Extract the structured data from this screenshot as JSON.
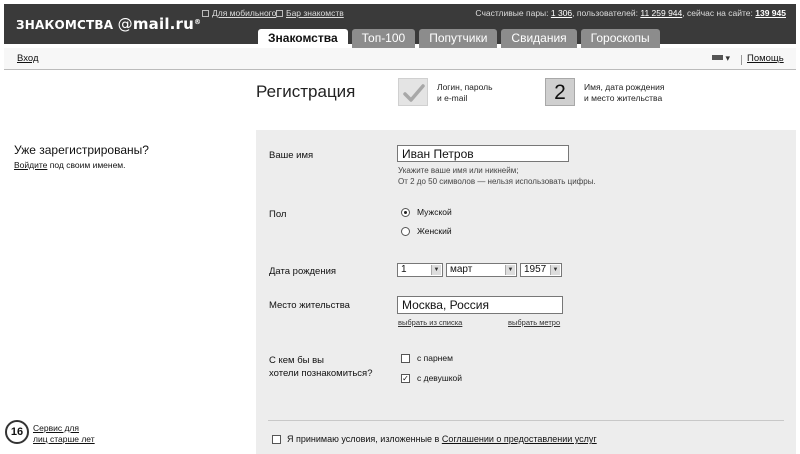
{
  "header": {
    "logo_brand": "ЗНАКОМСТВА",
    "logo_at": "@",
    "logo_mail": "mail.ru",
    "logo_reg": "®",
    "mobile_link": "Для мобильного",
    "bar_link": "Бар знакомств",
    "stats": {
      "pairs_label": "Счастливые пары:",
      "pairs": "1 306",
      "users_label": ", пользователей:",
      "users": "11 259 944",
      "online_label": ", сейчас на сайте:",
      "online": "139 945"
    },
    "tabs": [
      {
        "label": "Знакомства",
        "active": true
      },
      {
        "label": "Топ-100",
        "active": false
      },
      {
        "label": "Попутчики",
        "active": false
      },
      {
        "label": "Свидания",
        "active": false
      },
      {
        "label": "Гороскопы",
        "active": false
      }
    ]
  },
  "subbar": {
    "login": "Вход",
    "lang_arrow": "▾",
    "help": "Помощь"
  },
  "registration": {
    "title": "Регистрация",
    "step1": {
      "line1": "Логин, пароль",
      "line2": "и e-mail",
      "icon": "checkmark-icon"
    },
    "step2": {
      "number": "2",
      "line1": "Имя, дата рождения",
      "line2": "и место жительства"
    }
  },
  "left": {
    "title": "Уже зарегистрированы?",
    "login_link": "Войдите",
    "login_rest": " под своим именем.",
    "age_badge": "16",
    "age_line1": "Сервис для",
    "age_line2": "лиц старше лет"
  },
  "form": {
    "name_label": "Ваше имя",
    "name_value": "Иван Петров",
    "name_hint1": "Укажите ваше имя или никнейм;",
    "name_hint2": "От 2 до 50 символов — нельзя использовать цифры.",
    "gender_label": "Пол",
    "gender_male": "Мужской",
    "gender_female": "Женский",
    "gender_selected": "Мужской",
    "birth_label": "Дата рождения",
    "birth_day": "1",
    "birth_month": "март",
    "birth_year": "1957",
    "city_label": "Место жительства",
    "city_value": "Москва, Россия",
    "city_pick_list": "выбрать из списка",
    "city_pick_metro": "выбрать метро",
    "seek_label1": "С кем бы вы",
    "seek_label2": "хотели познакомиться?",
    "seek_man": "с парнем",
    "seek_woman": "с девушкой",
    "seek_man_checked": false,
    "seek_woman_checked": true,
    "agree_text": "Я принимаю условия, изложенные в ",
    "agree_link": "Соглашении о предоставлении услуг"
  }
}
